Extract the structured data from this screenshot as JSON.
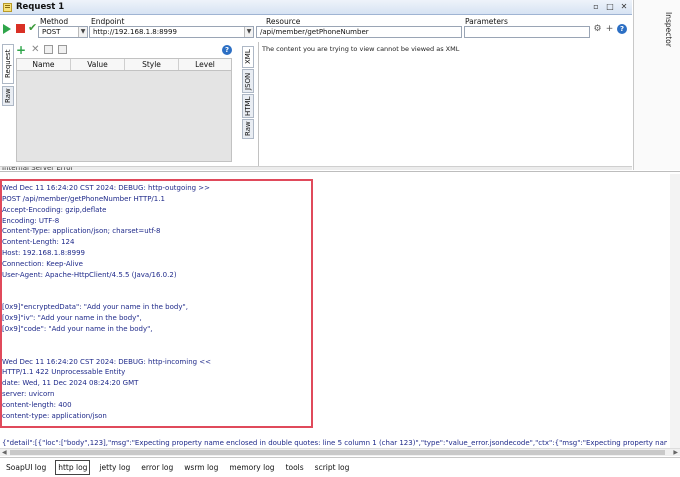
{
  "window": {
    "title": "Request 1",
    "inspector_label": "Inspector"
  },
  "toolbar": {
    "method_label": "Method",
    "method_value": "POST",
    "endpoint_label": "Endpoint",
    "endpoint_value": "http://192.168.1.8:8999",
    "resource_label": "Resource",
    "resource_value": "/api/member/getPhoneNumber",
    "parameters_label": "Parameters",
    "parameters_value": ""
  },
  "request": {
    "tabs": [
      "Request",
      "Raw"
    ],
    "columns": [
      "Name",
      "Value",
      "Style",
      "Level"
    ]
  },
  "response": {
    "tabs": [
      "XML",
      "JSON",
      "HTML",
      "Raw"
    ],
    "message": "The content you are trying to view cannot be viewed as XML"
  },
  "status_partial": "Internal Server Error",
  "log": {
    "lines": [
      "Wed Dec 11 16:24:20 CST 2024: DEBUG: http-outgoing >>",
      "POST /api/member/getPhoneNumber HTTP/1.1",
      "Accept-Encoding: gzip,deflate",
      "Encoding: UTF-8",
      "Content-Type:  application/json; charset=utf-8",
      "Content-Length: 124",
      "Host: 192.168.1.8:8999",
      "Connection: Keep-Alive",
      "User-Agent: Apache-HttpClient/4.5.5 (Java/16.0.2)",
      "",
      "",
      "[0x9]\"encryptedData\": \"Add your name in the body\",",
      "[0x9]\"iv\": \"Add your name in the body\",",
      "[0x9]\"code\": \"Add your name in the body\",",
      "",
      "",
      "Wed Dec 11 16:24:20 CST 2024: DEBUG: http-incoming <<",
      "HTTP/1.1 422 Unprocessable Entity",
      "date: Wed, 11 Dec 2024 08:24:20 GMT",
      "server: uvicorn",
      "content-length: 400",
      "content-type: application/json"
    ],
    "detail": "{\"detail\":[{\"loc\":[\"body\",123],\"msg\":\"Expecting property name enclosed in double quotes: line 5 column 1 (char 123)\",\"type\":\"value_error.jsondecode\",\"ctx\":{\"msg\":\"Expecting property name enclosed in d"
  },
  "bottom_tabs": [
    {
      "label": "SoapUI log",
      "active": false
    },
    {
      "label": "http log",
      "active": true
    },
    {
      "label": "jetty log",
      "active": false
    },
    {
      "label": "error log",
      "active": false
    },
    {
      "label": "wsrm log",
      "active": false
    },
    {
      "label": "memory log",
      "active": false
    },
    {
      "label": "tools",
      "active": false
    },
    {
      "label": "script log",
      "active": false
    }
  ],
  "colors": {
    "highlight": "#e04a5b",
    "log_text": "#1f2a8a"
  }
}
